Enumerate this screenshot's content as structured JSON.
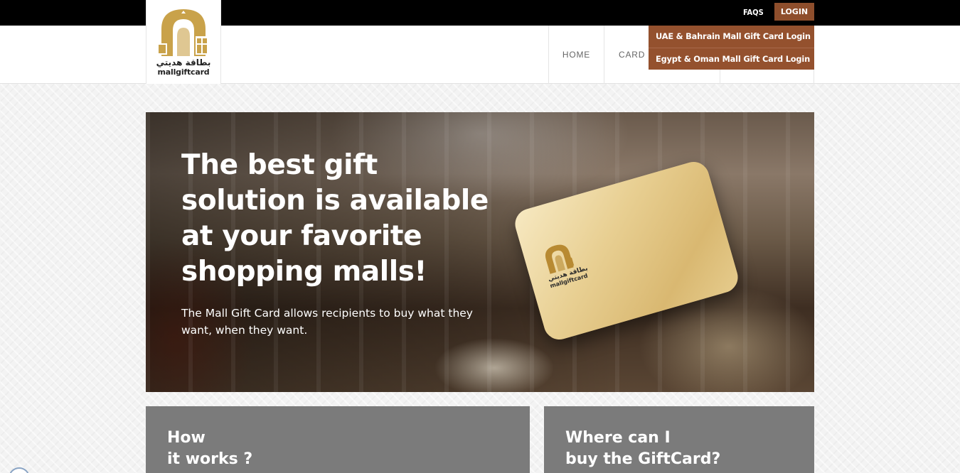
{
  "topbar": {
    "faqs_label": "FAQS",
    "login_label": "LOGIN"
  },
  "logo": {
    "arabic_text": "بطاقة هديتي",
    "latin_text": "mallgiftcard",
    "brand_color": "#c9a24a"
  },
  "nav": {
    "items": [
      {
        "label": "HOME"
      },
      {
        "label": "CARD INFO"
      },
      {
        "label": ""
      }
    ]
  },
  "login_dropdown": {
    "items": [
      {
        "label": "UAE & Bahrain Mall Gift Card Login"
      },
      {
        "label": "Egypt & Oman Mall Gift Card Login"
      }
    ]
  },
  "hero": {
    "title": "The best gift solution is available at your favorite shopping malls!",
    "subtitle": "The Mall Gift Card allows recipients to buy what they want, when they want.",
    "card_arabic": "بطاقة هديتي",
    "card_latin": "mallgiftcard"
  },
  "panels": {
    "how": {
      "line1": "How",
      "line2": "it works ?"
    },
    "where": {
      "line1": "Where can I",
      "line2": "buy the GiftCard?"
    }
  },
  "colors": {
    "accent": "#8e4e2c",
    "dropdown_bg": "#94512e",
    "panel_bg": "#7b7b7b",
    "topbar_bg": "#000000"
  }
}
